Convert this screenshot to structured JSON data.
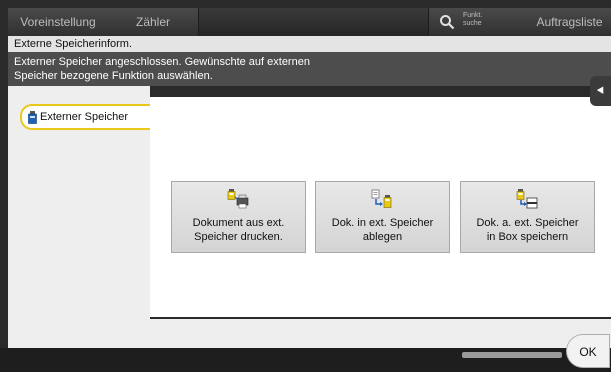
{
  "topbar": {
    "preset_tab": "Voreinstellung",
    "counter_tab": "Zähler",
    "search_label_line1": "Funkt.",
    "search_label_line2": "suche",
    "jobs_tab": "Auftragsliste"
  },
  "title": "Externe Speicherinform.",
  "info": {
    "line1": "Externer Speicher angeschlossen. Gewünschte auf externen",
    "line2": "Speicher bezogene Funktion auswählen."
  },
  "sidebar": {
    "items": [
      {
        "label": "Externer Speicher",
        "icon": "usb-memory-icon",
        "selected": true
      }
    ]
  },
  "functions": [
    {
      "line1": "Dokument aus ext.",
      "line2": "Speicher drucken.",
      "icon": "print-from-usb-icon"
    },
    {
      "line1": "Dok. in ext. Speicher",
      "line2": "ablegen",
      "icon": "save-to-usb-icon"
    },
    {
      "line1": "Dok. a. ext. Speicher",
      "line2": "in Box speichern",
      "icon": "usb-to-box-icon"
    }
  ],
  "ok_label": "OK",
  "colors": {
    "accent": "#e8c91a",
    "background": "#2a2a2a",
    "panel": "#ffffff"
  }
}
